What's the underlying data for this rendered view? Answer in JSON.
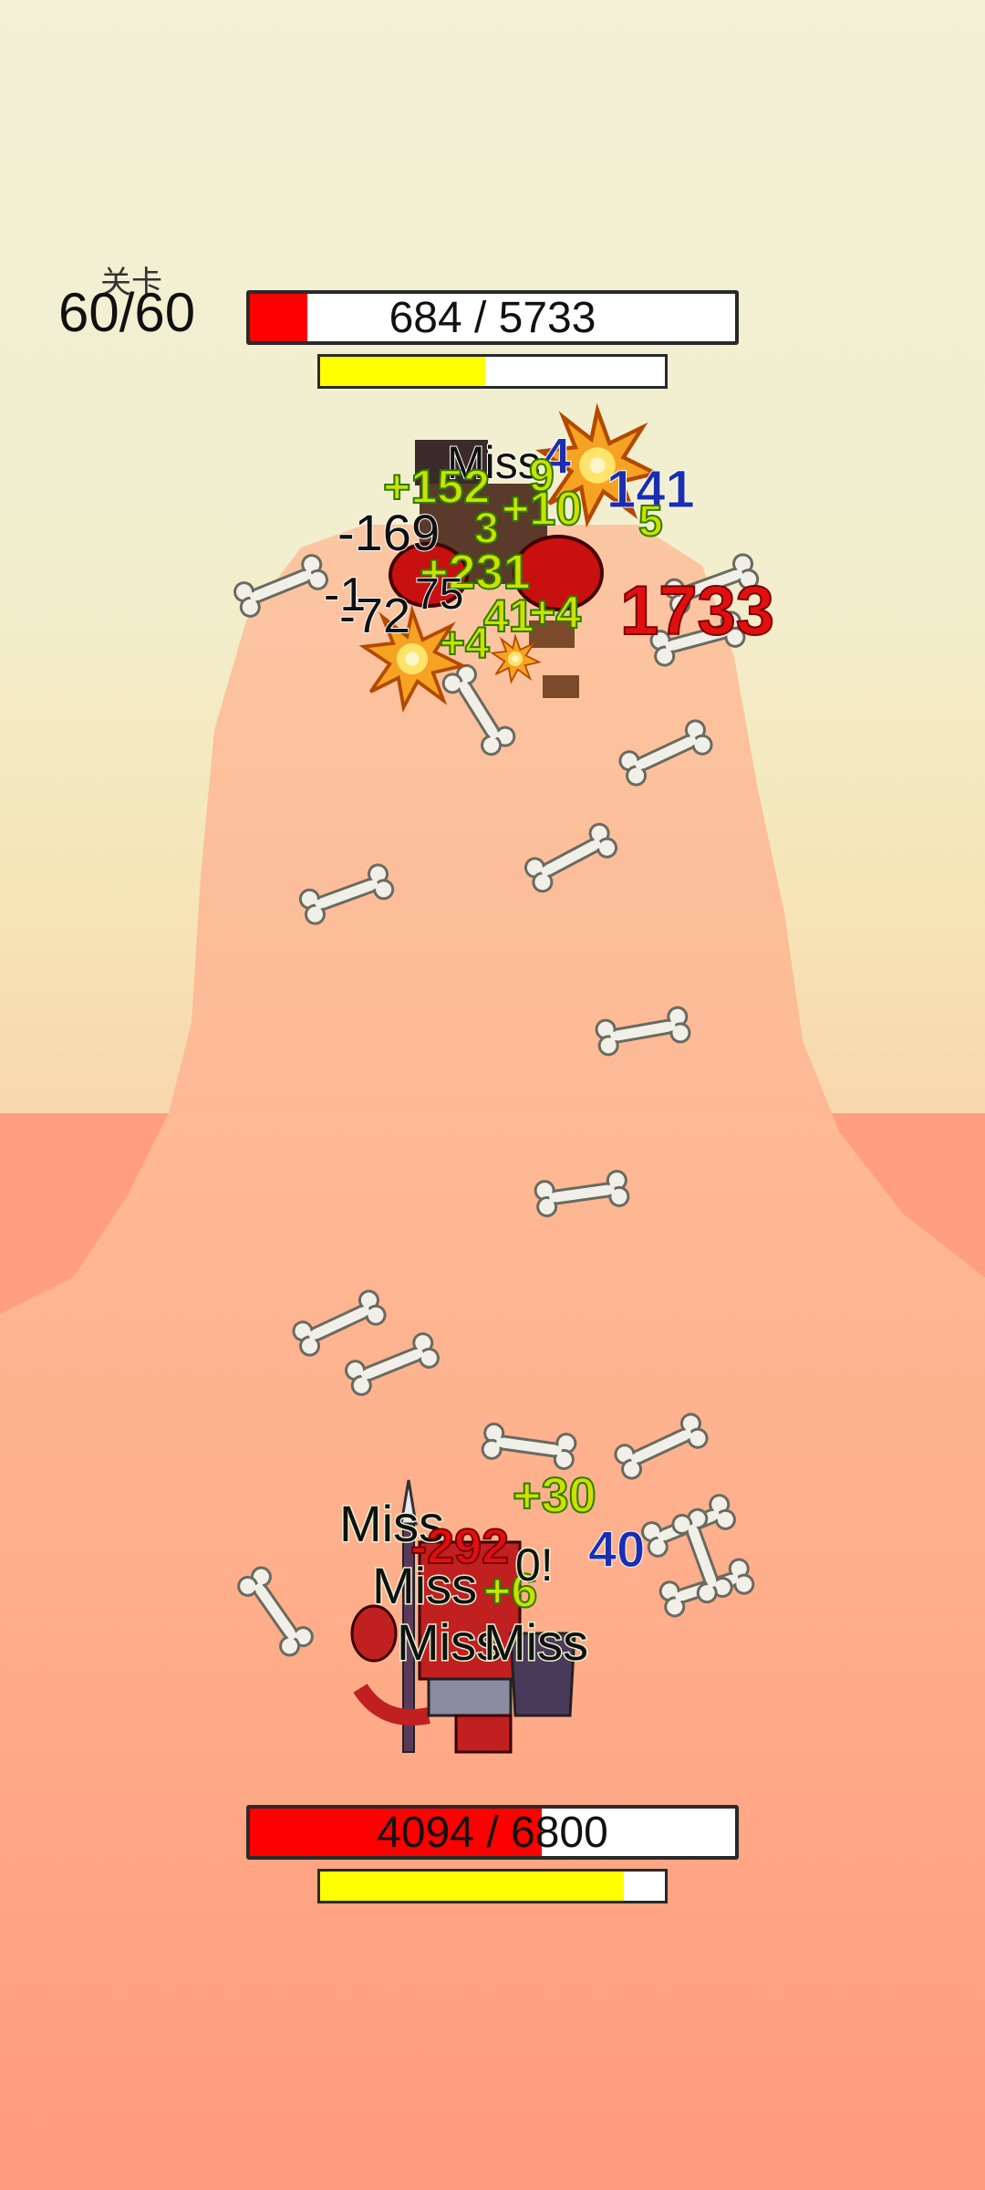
{
  "level": {
    "label": "关卡",
    "value": "60/60"
  },
  "enemy": {
    "hp_text": "684 / 5733",
    "hp_fraction": 0.119,
    "energy_fraction": 0.48
  },
  "player": {
    "hp_text": "4094 / 6800",
    "hp_fraction": 0.602,
    "energy_fraction": 0.88
  },
  "colors": {
    "sky_top": "#f3f1d6",
    "sand": "#ff9b7e",
    "hp_fill": "#ff0000",
    "energy_fill": "#ffff00"
  },
  "floating_numbers_enemy": [
    "Miss",
    "+152",
    "4",
    "9",
    "141",
    "+10",
    "-169",
    "3",
    "5",
    "+231",
    "-1",
    "1733",
    "-72",
    "41",
    "+4",
    "75",
    "+4"
  ],
  "floating_numbers_player": [
    "+30",
    "Miss",
    "-292",
    "40",
    "Miss",
    "+6",
    "Miss",
    "Miss",
    "0!"
  ]
}
